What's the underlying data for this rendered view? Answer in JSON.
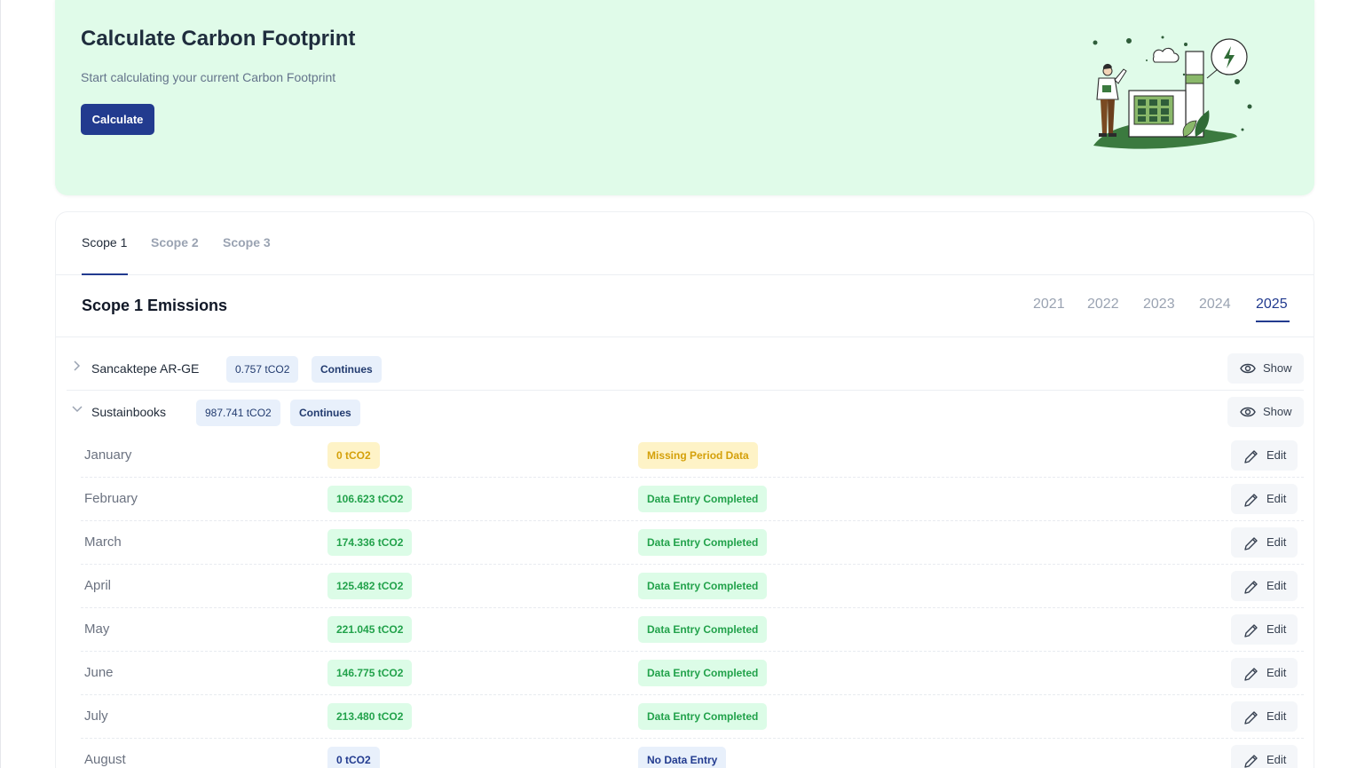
{
  "hero": {
    "title": "Calculate Carbon Footprint",
    "subtitle": "Start calculating your current Carbon Footprint",
    "button_label": "Calculate"
  },
  "tabs": [
    {
      "label": "Scope 1",
      "active": true
    },
    {
      "label": "Scope 2",
      "active": false
    },
    {
      "label": "Scope 3",
      "active": false
    }
  ],
  "section": {
    "title": "Scope 1 Emissions",
    "years": [
      "2021",
      "2022",
      "2023",
      "2024",
      "2025"
    ],
    "active_year": "2025"
  },
  "facilities": [
    {
      "name": "Sancaktepe AR-GE",
      "total": "0.757 tCO2",
      "status": "Continues",
      "button": "Show",
      "expanded": false
    },
    {
      "name": "Sustainbooks",
      "total": "987.741 tCO2",
      "status": "Continues",
      "button": "Show",
      "expanded": true
    }
  ],
  "months": [
    {
      "name": "January",
      "value": "0 tCO2",
      "status": "Missing Period Data",
      "kind": "missing",
      "action": "Edit"
    },
    {
      "name": "February",
      "value": "106.623 tCO2",
      "status": "Data Entry Completed",
      "kind": "completed",
      "action": "Edit"
    },
    {
      "name": "March",
      "value": "174.336 tCO2",
      "status": "Data Entry Completed",
      "kind": "completed",
      "action": "Edit"
    },
    {
      "name": "April",
      "value": "125.482 tCO2",
      "status": "Data Entry Completed",
      "kind": "completed",
      "action": "Edit"
    },
    {
      "name": "May",
      "value": "221.045 tCO2",
      "status": "Data Entry Completed",
      "kind": "completed",
      "action": "Edit"
    },
    {
      "name": "June",
      "value": "146.775 tCO2",
      "status": "Data Entry Completed",
      "kind": "completed",
      "action": "Edit"
    },
    {
      "name": "July",
      "value": "213.480 tCO2",
      "status": "Data Entry Completed",
      "kind": "completed",
      "action": "Edit"
    },
    {
      "name": "August",
      "value": "0 tCO2",
      "status": "No Data Entry",
      "kind": "none",
      "action": "Edit"
    }
  ],
  "icons": {
    "show": "eye-icon",
    "edit": "pencil-icon",
    "collapsed": "chevron-right-icon",
    "expanded": "chevron-down-icon"
  },
  "colors": {
    "primary": "#223b8f",
    "hero_bg": "#e0fbe9",
    "success": "#22a24b",
    "warning": "#d4a00a"
  }
}
